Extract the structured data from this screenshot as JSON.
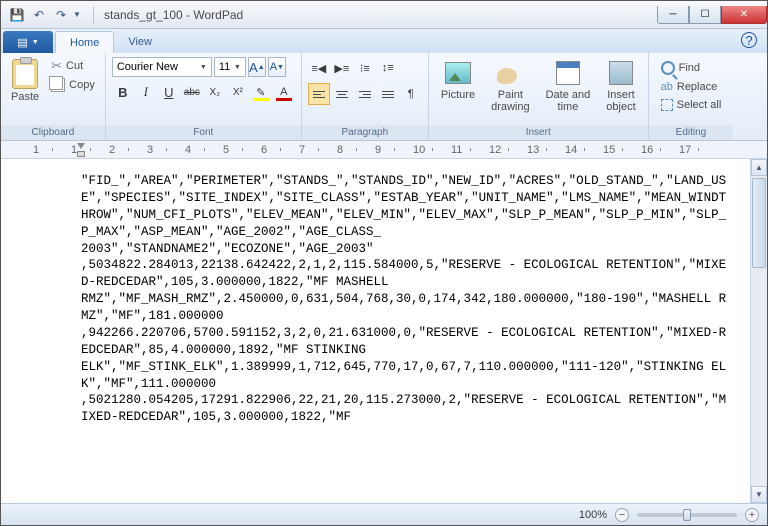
{
  "title": "stands_gt_100 - WordPad",
  "tabs": {
    "home": "Home",
    "view": "View"
  },
  "clipboard": {
    "paste": "Paste",
    "cut": "Cut",
    "copy": "Copy",
    "label": "Clipboard"
  },
  "font": {
    "name": "Courier New",
    "size": "11",
    "label": "Font",
    "grow": "A",
    "shrink": "A",
    "bold": "B",
    "italic": "I",
    "underline": "U",
    "strike": "abc",
    "sub": "X₂",
    "sup": "X²",
    "highlight": "",
    "color": "A"
  },
  "paragraph": {
    "label": "Paragraph"
  },
  "insert": {
    "picture": "Picture",
    "paint": "Paint\ndrawing",
    "date": "Date and\ntime",
    "object": "Insert\nobject",
    "label": "Insert"
  },
  "editing": {
    "find": "Find",
    "replace": "Replace",
    "selectall": "Select all",
    "label": "Editing"
  },
  "ruler_numbers": [
    1,
    1,
    2,
    3,
    4,
    5,
    6,
    7,
    8,
    9,
    10,
    11,
    12,
    13,
    14,
    15,
    16,
    17
  ],
  "document": "\"FID_\",\"AREA\",\"PERIMETER\",\"STANDS_\",\"STANDS_ID\",\"NEW_ID\",\"ACRES\",\"OLD_STAND_\",\"LAND_USE\",\"SPECIES\",\"SITE_INDEX\",\"SITE_CLASS\",\"ESTAB_YEAR\",\"UNIT_NAME\",\"LMS_NAME\",\"MEAN_WINDTHROW\",\"NUM_CFI_PLOTS\",\"ELEV_MEAN\",\"ELEV_MIN\",\"ELEV_MAX\",\"SLP_P_MEAN\",\"SLP_P_MIN\",\"SLP_P_MAX\",\"ASP_MEAN\",\"AGE_2002\",\"AGE_CLASS_\n2003\",\"STANDNAME2\",\"ECOZONE\",\"AGE_2003\"\n,5034822.284013,22138.642422,2,1,2,115.584000,5,\"RESERVE - ECOLOGICAL RETENTION\",\"MIXED-REDCEDAR\",105,3.000000,1822,\"MF MASHELL\nRMZ\",\"MF_MASH_RMZ\",2.450000,0,631,504,768,30,0,174,342,180.000000,\"180-190\",\"MASHELL RMZ\",\"MF\",181.000000\n,942266.220706,5700.591152,3,2,0,21.631000,0,\"RESERVE - ECOLOGICAL RETENTION\",\"MIXED-REDCEDAR\",85,4.000000,1892,\"MF STINKING\nELK\",\"MF_STINK_ELK\",1.389999,1,712,645,770,17,0,67,7,110.000000,\"111-120\",\"STINKING ELK\",\"MF\",111.000000\n,5021280.054205,17291.822906,22,21,20,115.273000,2,\"RESERVE - ECOLOGICAL RETENTION\",\"MIXED-REDCEDAR\",105,3.000000,1822,\"MF",
  "status": {
    "zoom": "100%"
  }
}
